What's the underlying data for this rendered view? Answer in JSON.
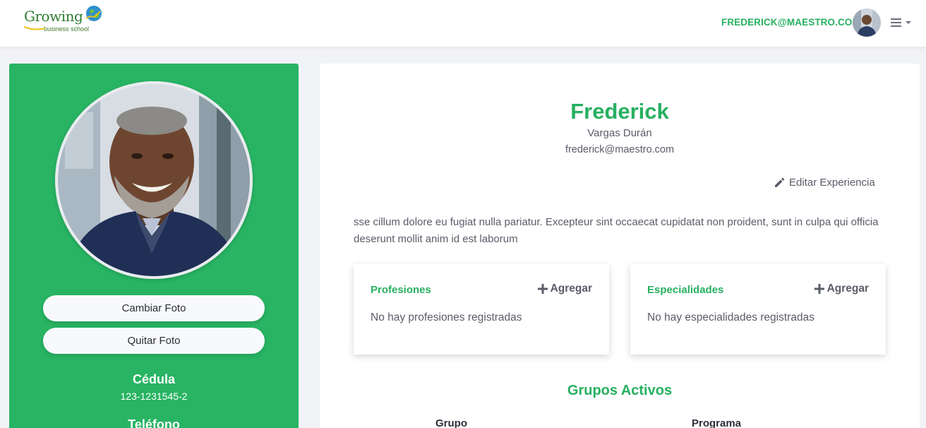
{
  "header": {
    "logo_text": "Growing",
    "logo_sub": "business school",
    "user_email": "FREDERICK@MAESTRO.COM"
  },
  "sidebar": {
    "change_photo_label": "Cambiar Foto",
    "remove_photo_label": "Quitar Foto",
    "id_label": "Cédula",
    "id_value": "123-1231545-2",
    "phone_label": "Teléfono"
  },
  "profile": {
    "first_name": "Frederick",
    "last_name": "Vargas Durán",
    "email": "frederick@maestro.com",
    "edit_label": "Editar Experiencia",
    "bio": "sse cillum dolore eu fugiat nulla pariatur. Excepteur sint occaecat cupidatat non proident, sunt in culpa qui officia deserunt mollit anim id est laborum"
  },
  "professions": {
    "title": "Profesiones",
    "add_label": "Agregar",
    "empty_message": "No hay profesiones registradas"
  },
  "specialties": {
    "title": "Especialidades",
    "add_label": "Agregar",
    "empty_message": "No hay especialidades registradas"
  },
  "groups": {
    "title": "Grupos Activos",
    "columns": [
      "Grupo",
      "Programa"
    ]
  },
  "colors": {
    "brand_green": "#27b060",
    "sidebar_green": "#28b463",
    "text_gray": "#5a5c69"
  },
  "icons": {
    "edit": "pencil-icon",
    "add": "plus-icon",
    "menu": "hamburger-icon",
    "dropdown": "caret-down-icon"
  }
}
